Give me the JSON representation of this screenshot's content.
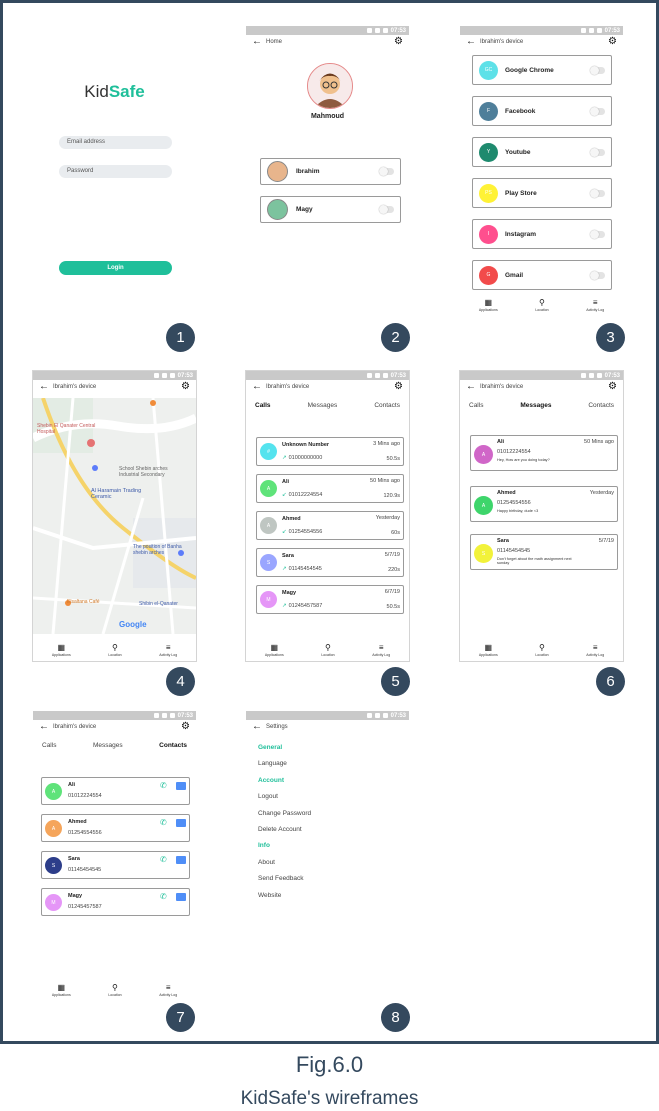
{
  "caption": {
    "fig": "Fig.6.0",
    "title": "KidSafe's wireframes"
  },
  "status_time": "07:53",
  "badges": [
    "1",
    "2",
    "3",
    "4",
    "5",
    "6",
    "7",
    "8"
  ],
  "s1": {
    "logo_a": "Kid",
    "logo_b": "Safe",
    "email_placeholder": "Email address",
    "password_placeholder": "Password",
    "login": "Login"
  },
  "s2": {
    "appbar": "Home",
    "parent_name": "Mahmoud",
    "children": [
      {
        "name": "Ibrahim"
      },
      {
        "name": "Magy"
      }
    ]
  },
  "device_title": "Ibrahim's device",
  "s3": {
    "apps": [
      {
        "abbr": "GC",
        "name": "Google Chrome",
        "color": "#5ee1e8"
      },
      {
        "abbr": "F",
        "name": "Facebook",
        "color": "#4f7f9a"
      },
      {
        "abbr": "Y",
        "name": "Youtube",
        "color": "#1e8a6e"
      },
      {
        "abbr": "PS",
        "name": "Play Store",
        "color": "#fff236"
      },
      {
        "abbr": "I",
        "name": "Instagram",
        "color": "#ff4f8e"
      },
      {
        "abbr": "G",
        "name": "Gmail",
        "color": "#f24b4b"
      }
    ]
  },
  "nav": {
    "applications": "Applications",
    "location": "Location",
    "activity": "Activity Log"
  },
  "tabs": {
    "calls": "Calls",
    "messages": "Messages",
    "contacts": "Contacts"
  },
  "s4": {
    "map_labels": [
      "Shebin El Qanater Central Hospital",
      "School Shebin arches Industrial Secondary",
      "Al Haramain Trading Ceramic",
      "The position of Banha shebin arches",
      "Elsaltana Café",
      "Shibin el-Qanater",
      "Google"
    ]
  },
  "s5": {
    "calls": [
      {
        "name": "Unknown Number",
        "num": "01000000000",
        "time": "3 Mins ago",
        "dur": "50.5s",
        "abbr": "#",
        "color": "#55e3ee",
        "dir": "↗"
      },
      {
        "name": "Ali",
        "num": "01012224554",
        "time": "50 Mins ago",
        "dur": "120.9s",
        "abbr": "A",
        "color": "#5fe37a",
        "dir": "↙"
      },
      {
        "name": "Ahmed",
        "num": "01254554556",
        "time": "Yesterday",
        "dur": "60s",
        "abbr": "A",
        "color": "#bfc6c2",
        "dir": "↙"
      },
      {
        "name": "Sara",
        "num": "01145454545",
        "time": "5/7/19",
        "dur": "220s",
        "abbr": "S",
        "color": "#9aa6ff",
        "dir": "↗"
      },
      {
        "name": "Magy",
        "num": "01245457587",
        "time": "6/7/19",
        "dur": "50.5s",
        "abbr": "M",
        "color": "#e596f7",
        "dir": "↗"
      }
    ]
  },
  "s6": {
    "messages": [
      {
        "name": "Ali",
        "num": "01012224554",
        "time": "50 Mins ago",
        "text": "Hey, How are you doing today?",
        "abbr": "A",
        "color": "#d066c8"
      },
      {
        "name": "Ahmed",
        "num": "01254554556",
        "time": "Yesterday",
        "text": "Happy birthday, dude <3",
        "abbr": "A",
        "color": "#3ed56b"
      },
      {
        "name": "Sara",
        "num": "01145454545",
        "time": "5/7/19",
        "text": "Don't forget about the math assignment next sunday",
        "abbr": "S",
        "color": "#f2f23a"
      }
    ]
  },
  "s7": {
    "contacts": [
      {
        "name": "Ali",
        "num": "01012224554",
        "abbr": "A",
        "color": "#5fe37a"
      },
      {
        "name": "Ahmed",
        "num": "01254554556",
        "abbr": "A",
        "color": "#f5a55b"
      },
      {
        "name": "Sara",
        "num": "01145454545",
        "abbr": "S",
        "color": "#2d3e8a"
      },
      {
        "name": "Magy",
        "num": "01245457587",
        "abbr": "M",
        "color": "#e596f7"
      }
    ]
  },
  "s8": {
    "appbar": "Settings",
    "items": [
      {
        "label": "General",
        "header": true
      },
      {
        "label": "Language",
        "header": false
      },
      {
        "label": "Account",
        "header": true
      },
      {
        "label": "Logout",
        "header": false
      },
      {
        "label": "Change Password",
        "header": false
      },
      {
        "label": "Delete Account",
        "header": false
      },
      {
        "label": "Info",
        "header": true
      },
      {
        "label": "About",
        "header": false
      },
      {
        "label": "Send Feedback",
        "header": false
      },
      {
        "label": "Website",
        "header": false
      }
    ]
  },
  "colors": {
    "accent": "#1fbf9a",
    "badge": "#34495e",
    "statusbar": "#c9c9c9"
  }
}
